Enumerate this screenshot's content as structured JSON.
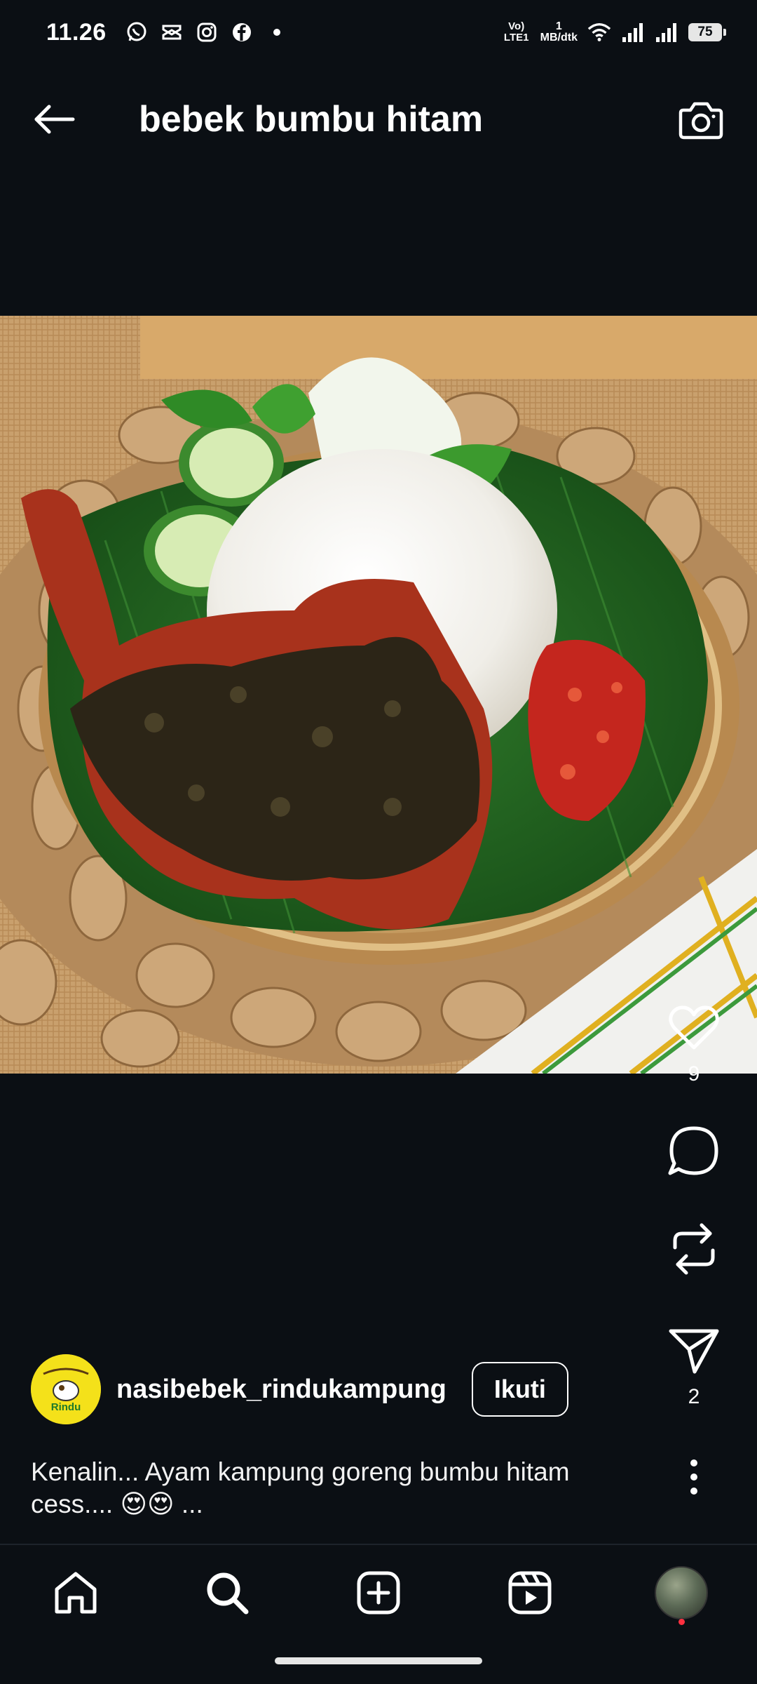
{
  "status_bar": {
    "time": "11.26",
    "network_label": "Vo) LTE1",
    "speed_value": "1",
    "speed_unit": "MB/dtk",
    "battery": "75"
  },
  "header": {
    "title": "bebek bumbu hitam"
  },
  "post": {
    "likes": "9",
    "shares": "2",
    "author": "nasibebek_rindukampung",
    "follow_label": "Ikuti",
    "caption": "Kenalin... Ayam kampung goreng bumbu hitam cess.... 😍😍 ...",
    "avatar_logo_text": "Rindu"
  },
  "colors": {
    "background": "#0b0f14",
    "text": "#ffffff",
    "notification": "#ff3040",
    "avatar_yellow": "#f4e11a"
  },
  "icons": {
    "back": "arrow-left-icon",
    "camera": "camera-icon",
    "like": "heart-icon",
    "comment": "comment-icon",
    "repost": "repost-icon",
    "share": "send-icon",
    "more": "more-vertical-icon",
    "home": "home-icon",
    "search": "search-icon",
    "create": "plus-square-icon",
    "reels": "reels-icon",
    "profile": "profile-avatar"
  }
}
